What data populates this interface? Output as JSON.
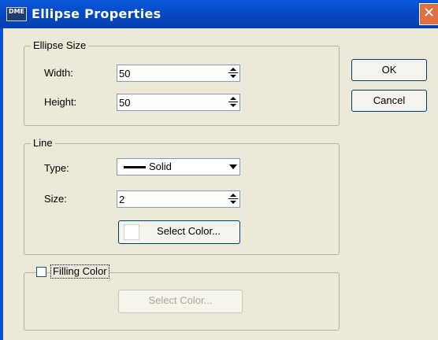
{
  "window": {
    "title": "Ellipse Properties",
    "app_icon_text": "DME",
    "close_glyph": "✕"
  },
  "ellipse_size": {
    "legend": "Ellipse Size",
    "width_label": "Width:",
    "width_value": "50",
    "height_label": "Height:",
    "height_value": "50"
  },
  "line": {
    "legend": "Line",
    "type_label": "Type:",
    "type_value": "Solid",
    "size_label": "Size:",
    "size_value": "2",
    "select_color_label": "Select Color..."
  },
  "filling": {
    "checkbox_label": "Filling Color",
    "checked": false,
    "select_color_label": "Select Color...",
    "select_color_enabled": false
  },
  "buttons": {
    "ok": "OK",
    "cancel": "Cancel"
  },
  "colors": {
    "title_bar": "#0548c4",
    "dialog_bg": "#ece9d8",
    "close_button": "#e07040",
    "line_color": "#000000",
    "selected_swatch": "#ffffff"
  },
  "icons": [
    "app-icon",
    "close-icon",
    "spin-up-icon",
    "spin-down-icon",
    "dropdown-arrow-icon"
  ]
}
